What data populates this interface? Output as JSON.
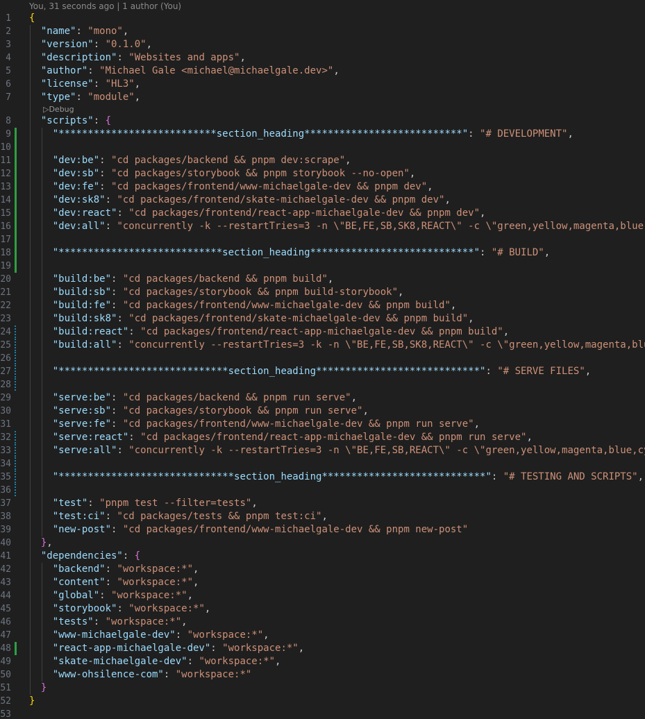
{
  "editor": {
    "blame": "You, 31 seconds ago | 1 author (You)",
    "codelens": "▷Debug",
    "lines": [
      {
        "n": "1",
        "t": [
          [
            "{",
            "b1"
          ]
        ],
        "g": ""
      },
      {
        "n": "2",
        "t": [
          [
            "  ",
            "p"
          ],
          [
            "\"name\"",
            "k"
          ],
          [
            ": ",
            "p"
          ],
          [
            "\"mono\"",
            "s"
          ],
          [
            ",",
            "p"
          ]
        ],
        "g": ""
      },
      {
        "n": "3",
        "t": [
          [
            "  ",
            "p"
          ],
          [
            "\"version\"",
            "k"
          ],
          [
            ": ",
            "p"
          ],
          [
            "\"0.1.0\"",
            "s"
          ],
          [
            ",",
            "p"
          ]
        ],
        "g": ""
      },
      {
        "n": "4",
        "t": [
          [
            "  ",
            "p"
          ],
          [
            "\"description\"",
            "k"
          ],
          [
            ": ",
            "p"
          ],
          [
            "\"Websites and apps\"",
            "s"
          ],
          [
            ",",
            "p"
          ]
        ],
        "g": ""
      },
      {
        "n": "5",
        "t": [
          [
            "  ",
            "p"
          ],
          [
            "\"author\"",
            "k"
          ],
          [
            ": ",
            "p"
          ],
          [
            "\"Michael Gale <michael@michaelgale.dev>\"",
            "s"
          ],
          [
            ",",
            "p"
          ]
        ],
        "g": ""
      },
      {
        "n": "6",
        "t": [
          [
            "  ",
            "p"
          ],
          [
            "\"license\"",
            "k"
          ],
          [
            ": ",
            "p"
          ],
          [
            "\"HL3\"",
            "s"
          ],
          [
            ",",
            "p"
          ]
        ],
        "g": ""
      },
      {
        "n": "7",
        "t": [
          [
            "  ",
            "p"
          ],
          [
            "\"type\"",
            "k"
          ],
          [
            ": ",
            "p"
          ],
          [
            "\"module\"",
            "s"
          ],
          [
            ",",
            "p"
          ]
        ],
        "g": ""
      },
      {
        "lens": true
      },
      {
        "n": "8",
        "t": [
          [
            "  ",
            "p"
          ],
          [
            "\"scripts\"",
            "k"
          ],
          [
            ": ",
            "p"
          ],
          [
            "{",
            "b2"
          ]
        ],
        "g": ""
      },
      {
        "n": "9",
        "t": [
          [
            "    ",
            "p"
          ],
          [
            "\"***************************section_heading***************************\"",
            "k"
          ],
          [
            ": ",
            "p"
          ],
          [
            "\"# DEVELOPMENT\"",
            "s"
          ],
          [
            ",",
            "p"
          ]
        ],
        "g": "added"
      },
      {
        "n": "10",
        "t": [],
        "g": "added"
      },
      {
        "n": "11",
        "t": [
          [
            "    ",
            "p"
          ],
          [
            "\"dev:be\"",
            "k"
          ],
          [
            ": ",
            "p"
          ],
          [
            "\"cd packages/backend && pnpm dev:scrape\"",
            "s"
          ],
          [
            ",",
            "p"
          ]
        ],
        "g": "added"
      },
      {
        "n": "12",
        "t": [
          [
            "    ",
            "p"
          ],
          [
            "\"dev:sb\"",
            "k"
          ],
          [
            ": ",
            "p"
          ],
          [
            "\"cd packages/storybook && pnpm storybook --no-open\"",
            "s"
          ],
          [
            ",",
            "p"
          ]
        ],
        "g": "added"
      },
      {
        "n": "13",
        "t": [
          [
            "    ",
            "p"
          ],
          [
            "\"dev:fe\"",
            "k"
          ],
          [
            ": ",
            "p"
          ],
          [
            "\"cd packages/frontend/www-michaelgale-dev && pnpm dev\"",
            "s"
          ],
          [
            ",",
            "p"
          ]
        ],
        "g": "added"
      },
      {
        "n": "14",
        "t": [
          [
            "    ",
            "p"
          ],
          [
            "\"dev:sk8\"",
            "k"
          ],
          [
            ": ",
            "p"
          ],
          [
            "\"cd packages/frontend/skate-michaelgale-dev && pnpm dev\"",
            "s"
          ],
          [
            ",",
            "p"
          ]
        ],
        "g": "added"
      },
      {
        "n": "15",
        "t": [
          [
            "    ",
            "p"
          ],
          [
            "\"dev:react\"",
            "k"
          ],
          [
            ": ",
            "p"
          ],
          [
            "\"cd packages/frontend/react-app-michaelgale-dev && pnpm dev\"",
            "s"
          ],
          [
            ",",
            "p"
          ]
        ],
        "g": "added"
      },
      {
        "n": "16",
        "t": [
          [
            "    ",
            "p"
          ],
          [
            "\"dev:all\"",
            "k"
          ],
          [
            ": ",
            "p"
          ],
          [
            "\"concurrently -k --restartTries=3 -n \\\"BE,FE,SB,SK8,REACT\\\" -c \\\"green,yellow,magenta,blue",
            "s"
          ]
        ],
        "g": "added"
      },
      {
        "n": "17",
        "t": [],
        "g": "added"
      },
      {
        "n": "18",
        "t": [
          [
            "    ",
            "p"
          ],
          [
            "\"****************************section_heading****************************\"",
            "k"
          ],
          [
            ": ",
            "p"
          ],
          [
            "\"# BUILD\"",
            "s"
          ],
          [
            ",",
            "p"
          ]
        ],
        "g": "added"
      },
      {
        "n": "19",
        "t": [],
        "g": "added"
      },
      {
        "n": "20",
        "t": [
          [
            "    ",
            "p"
          ],
          [
            "\"build:be\"",
            "k"
          ],
          [
            ": ",
            "p"
          ],
          [
            "\"cd packages/backend && pnpm build\"",
            "s"
          ],
          [
            ",",
            "p"
          ]
        ],
        "g": ""
      },
      {
        "n": "21",
        "t": [
          [
            "    ",
            "p"
          ],
          [
            "\"build:sb\"",
            "k"
          ],
          [
            ": ",
            "p"
          ],
          [
            "\"cd packages/storybook && pnpm build-storybook\"",
            "s"
          ],
          [
            ",",
            "p"
          ]
        ],
        "g": ""
      },
      {
        "n": "22",
        "t": [
          [
            "    ",
            "p"
          ],
          [
            "\"build:fe\"",
            "k"
          ],
          [
            ": ",
            "p"
          ],
          [
            "\"cd packages/frontend/www-michaelgale-dev && pnpm build\"",
            "s"
          ],
          [
            ",",
            "p"
          ]
        ],
        "g": ""
      },
      {
        "n": "23",
        "t": [
          [
            "    ",
            "p"
          ],
          [
            "\"build:sk8\"",
            "k"
          ],
          [
            ": ",
            "p"
          ],
          [
            "\"cd packages/frontend/skate-michaelgale-dev && pnpm build\"",
            "s"
          ],
          [
            ",",
            "p"
          ]
        ],
        "g": ""
      },
      {
        "n": "24",
        "t": [
          [
            "    ",
            "p"
          ],
          [
            "\"build:react\"",
            "k"
          ],
          [
            ": ",
            "p"
          ],
          [
            "\"cd packages/frontend/react-app-michaelgale-dev && pnpm build\"",
            "s"
          ],
          [
            ",",
            "p"
          ]
        ],
        "g": "modified"
      },
      {
        "n": "25",
        "t": [
          [
            "    ",
            "p"
          ],
          [
            "\"build:all\"",
            "k"
          ],
          [
            ": ",
            "p"
          ],
          [
            "\"concurrently --restartTries=3 -k -n \\\"BE,FE,SB,SK8,REACT\\\" -c \\\"green,yellow,magenta,blu",
            "s"
          ]
        ],
        "g": "modified"
      },
      {
        "n": "26",
        "t": [],
        "g": "modified"
      },
      {
        "n": "27",
        "t": [
          [
            "    ",
            "p"
          ],
          [
            "\"*****************************section_heading****************************\"",
            "k"
          ],
          [
            ": ",
            "p"
          ],
          [
            "\"# SERVE FILES\"",
            "s"
          ],
          [
            ",",
            "p"
          ]
        ],
        "g": "modified"
      },
      {
        "n": "28",
        "t": [],
        "g": "modified"
      },
      {
        "n": "29",
        "t": [
          [
            "    ",
            "p"
          ],
          [
            "\"serve:be\"",
            "k"
          ],
          [
            ": ",
            "p"
          ],
          [
            "\"cd packages/backend && pnpm run serve\"",
            "s"
          ],
          [
            ",",
            "p"
          ]
        ],
        "g": ""
      },
      {
        "n": "30",
        "t": [
          [
            "    ",
            "p"
          ],
          [
            "\"serve:sb\"",
            "k"
          ],
          [
            ": ",
            "p"
          ],
          [
            "\"cd packages/storybook && pnpm run serve\"",
            "s"
          ],
          [
            ",",
            "p"
          ]
        ],
        "g": ""
      },
      {
        "n": "31",
        "t": [
          [
            "    ",
            "p"
          ],
          [
            "\"serve:fe\"",
            "k"
          ],
          [
            ": ",
            "p"
          ],
          [
            "\"cd packages/frontend/www-michaelgale-dev && pnpm run serve\"",
            "s"
          ],
          [
            ",",
            "p"
          ]
        ],
        "g": ""
      },
      {
        "n": "32",
        "t": [
          [
            "    ",
            "p"
          ],
          [
            "\"serve:react\"",
            "k"
          ],
          [
            ": ",
            "p"
          ],
          [
            "\"cd packages/frontend/react-app-michaelgale-dev && pnpm run serve\"",
            "s"
          ],
          [
            ",",
            "p"
          ]
        ],
        "g": "modified"
      },
      {
        "n": "33",
        "t": [
          [
            "    ",
            "p"
          ],
          [
            "\"serve:all\"",
            "k"
          ],
          [
            ": ",
            "p"
          ],
          [
            "\"concurrently -k --restartTries=3 -n \\\"BE,FE,SB,REACT\\\" -c \\\"green,yellow,magenta,blue,cy",
            "s"
          ]
        ],
        "g": "modified"
      },
      {
        "n": "34",
        "t": [],
        "g": "modified"
      },
      {
        "n": "35",
        "t": [
          [
            "    ",
            "p"
          ],
          [
            "\"******************************section_heading****************************\"",
            "k"
          ],
          [
            ": ",
            "p"
          ],
          [
            "\"# TESTING AND SCRIPTS\"",
            "s"
          ],
          [
            ",",
            "p"
          ]
        ],
        "g": "modified"
      },
      {
        "n": "36",
        "t": [],
        "g": "modified"
      },
      {
        "n": "37",
        "t": [
          [
            "    ",
            "p"
          ],
          [
            "\"test\"",
            "k"
          ],
          [
            ": ",
            "p"
          ],
          [
            "\"pnpm test --filter=tests\"",
            "s"
          ],
          [
            ",",
            "p"
          ]
        ],
        "g": ""
      },
      {
        "n": "38",
        "t": [
          [
            "    ",
            "p"
          ],
          [
            "\"test:ci\"",
            "k"
          ],
          [
            ": ",
            "p"
          ],
          [
            "\"cd packages/tests && pnpm test:ci\"",
            "s"
          ],
          [
            ",",
            "p"
          ]
        ],
        "g": ""
      },
      {
        "n": "39",
        "t": [
          [
            "    ",
            "p"
          ],
          [
            "\"new-post\"",
            "k"
          ],
          [
            ": ",
            "p"
          ],
          [
            "\"cd packages/frontend/www-michaelgale-dev && pnpm new-post\"",
            "s"
          ]
        ],
        "g": ""
      },
      {
        "n": "40",
        "t": [
          [
            "  ",
            "p"
          ],
          [
            "}",
            "b2"
          ],
          [
            ",",
            "p"
          ]
        ],
        "g": ""
      },
      {
        "n": "41",
        "t": [
          [
            "  ",
            "p"
          ],
          [
            "\"dependencies\"",
            "k"
          ],
          [
            ": ",
            "p"
          ],
          [
            "{",
            "b2"
          ]
        ],
        "g": ""
      },
      {
        "n": "42",
        "t": [
          [
            "    ",
            "p"
          ],
          [
            "\"backend\"",
            "k"
          ],
          [
            ": ",
            "p"
          ],
          [
            "\"workspace:*\"",
            "s"
          ],
          [
            ",",
            "p"
          ]
        ],
        "g": ""
      },
      {
        "n": "43",
        "t": [
          [
            "    ",
            "p"
          ],
          [
            "\"content\"",
            "k"
          ],
          [
            ": ",
            "p"
          ],
          [
            "\"workspace:*\"",
            "s"
          ],
          [
            ",",
            "p"
          ]
        ],
        "g": ""
      },
      {
        "n": "44",
        "t": [
          [
            "    ",
            "p"
          ],
          [
            "\"global\"",
            "k"
          ],
          [
            ": ",
            "p"
          ],
          [
            "\"workspace:*\"",
            "s"
          ],
          [
            ",",
            "p"
          ]
        ],
        "g": ""
      },
      {
        "n": "45",
        "t": [
          [
            "    ",
            "p"
          ],
          [
            "\"storybook\"",
            "k"
          ],
          [
            ": ",
            "p"
          ],
          [
            "\"workspace:*\"",
            "s"
          ],
          [
            ",",
            "p"
          ]
        ],
        "g": ""
      },
      {
        "n": "46",
        "t": [
          [
            "    ",
            "p"
          ],
          [
            "\"tests\"",
            "k"
          ],
          [
            ": ",
            "p"
          ],
          [
            "\"workspace:*\"",
            "s"
          ],
          [
            ",",
            "p"
          ]
        ],
        "g": ""
      },
      {
        "n": "47",
        "t": [
          [
            "    ",
            "p"
          ],
          [
            "\"www-michaelgale-dev\"",
            "k"
          ],
          [
            ": ",
            "p"
          ],
          [
            "\"workspace:*\"",
            "s"
          ],
          [
            ",",
            "p"
          ]
        ],
        "g": ""
      },
      {
        "n": "48",
        "t": [
          [
            "    ",
            "p"
          ],
          [
            "\"react-app-michaelgale-dev\"",
            "k"
          ],
          [
            ": ",
            "p"
          ],
          [
            "\"workspace:*\"",
            "s"
          ],
          [
            ",",
            "p"
          ]
        ],
        "g": "added"
      },
      {
        "n": "49",
        "t": [
          [
            "    ",
            "p"
          ],
          [
            "\"skate-michaelgale-dev\"",
            "k"
          ],
          [
            ": ",
            "p"
          ],
          [
            "\"workspace:*\"",
            "s"
          ],
          [
            ",",
            "p"
          ]
        ],
        "g": ""
      },
      {
        "n": "50",
        "t": [
          [
            "    ",
            "p"
          ],
          [
            "\"www-ohsilence-com\"",
            "k"
          ],
          [
            ": ",
            "p"
          ],
          [
            "\"workspace:*\"",
            "s"
          ]
        ],
        "g": ""
      },
      {
        "n": "51",
        "t": [
          [
            "  ",
            "p"
          ],
          [
            "}",
            "b2"
          ]
        ],
        "g": ""
      },
      {
        "n": "52",
        "t": [
          [
            "}",
            "b1"
          ]
        ],
        "g": ""
      },
      {
        "n": "53",
        "t": [],
        "g": ""
      }
    ]
  }
}
